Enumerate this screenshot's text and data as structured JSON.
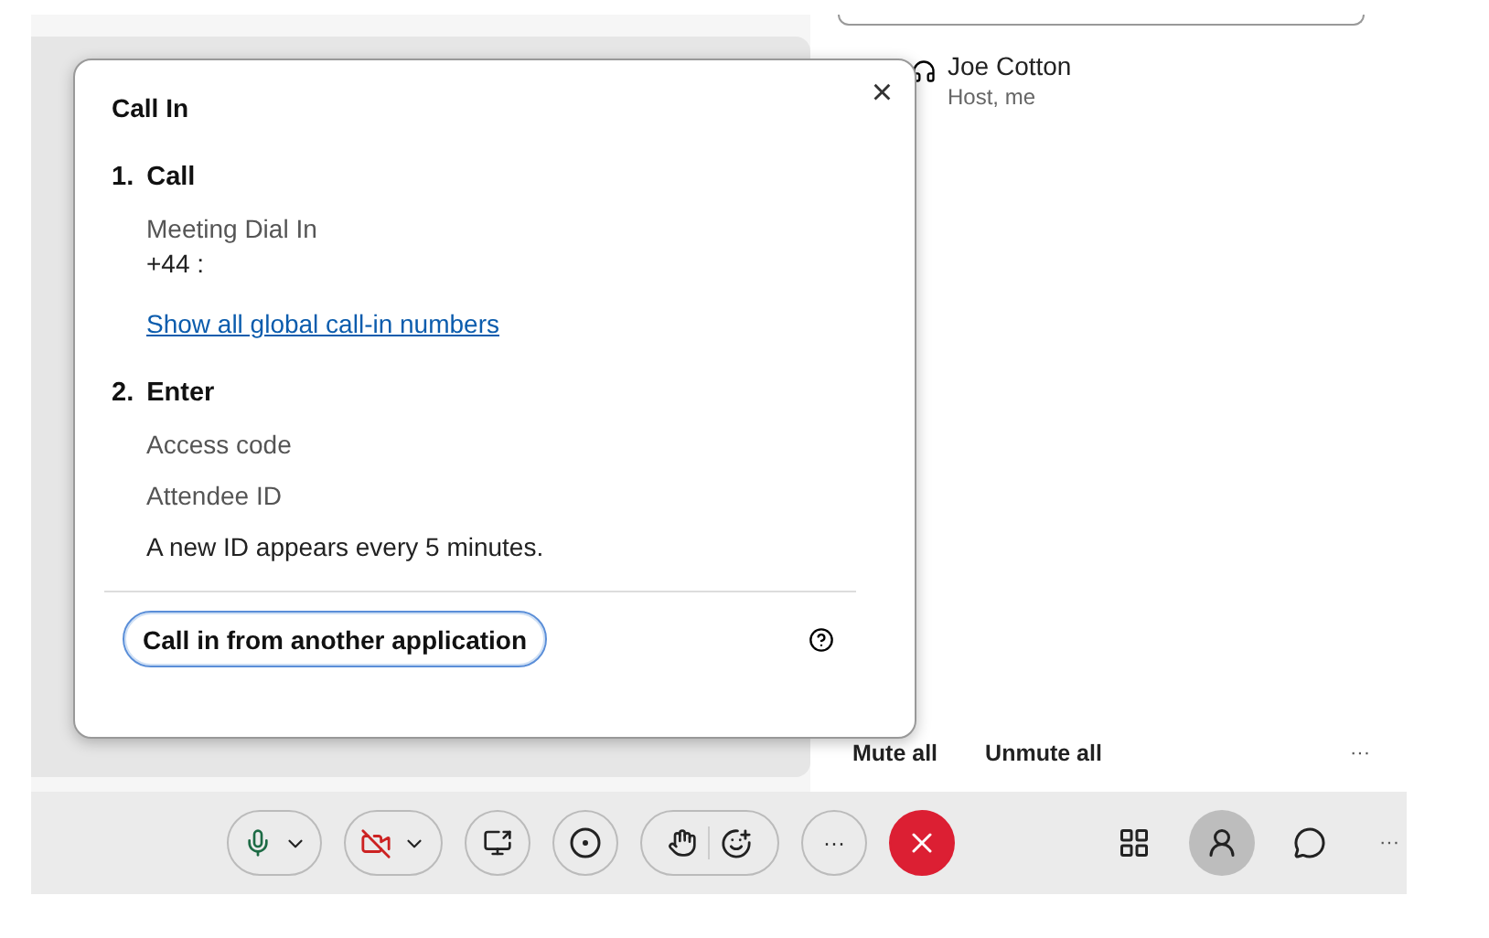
{
  "participants": [
    {
      "name": "Joe Cotton",
      "role": "Host, me"
    }
  ],
  "participant_actions": [
    "Mute all",
    "Unmute all"
  ],
  "participant_more": "···",
  "dialog": {
    "title": "Call In",
    "close": "×",
    "steps": [
      {
        "number": "1.",
        "title": "Call",
        "lines": [
          {
            "kind": "label",
            "text": "Meeting Dial In"
          },
          {
            "kind": "value",
            "text": "+44 :"
          },
          {
            "kind": "link",
            "text": "Show all global call-in numbers"
          }
        ]
      },
      {
        "number": "2.",
        "title": "Enter",
        "lines": [
          {
            "kind": "label",
            "text": "Access code"
          },
          {
            "kind": "label",
            "text": "Attendee ID"
          },
          {
            "kind": "note",
            "text": "A new ID appears every 5 minutes."
          }
        ]
      }
    ],
    "button": "Call in from another application"
  },
  "toolbar": {
    "video_on": false,
    "more": "···",
    "side_more": "···",
    "side": [
      {
        "kind": "apps",
        "selected": false
      },
      {
        "kind": "participants",
        "selected": true
      },
      {
        "kind": "chat",
        "selected": false
      }
    ]
  }
}
